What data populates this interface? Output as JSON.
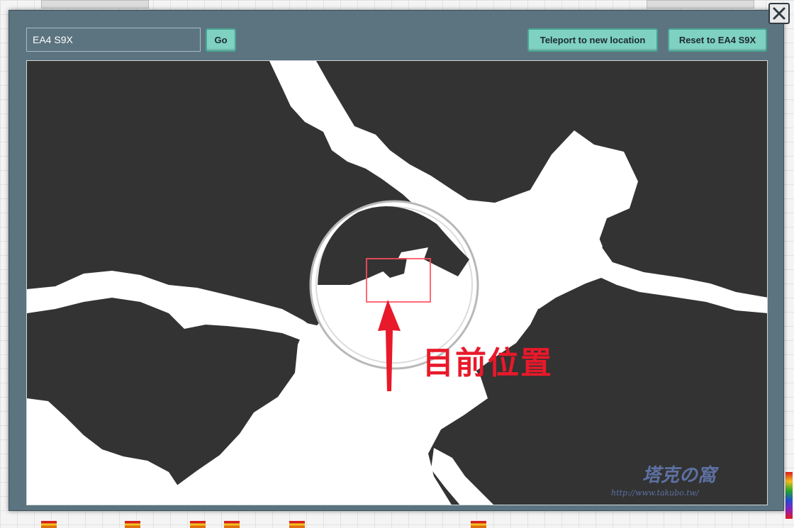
{
  "search": {
    "value": "EA4 S9X"
  },
  "buttons": {
    "go": "Go",
    "teleport": "Teleport to new location",
    "reset": "Reset to EA4 S9X"
  },
  "annotation": {
    "label": "目前位置"
  },
  "watermark": {
    "title": "塔克の窩",
    "url": "http://www.takubo.tw/"
  },
  "icons": {
    "close": "close-icon"
  },
  "colors": {
    "modal_bg": "#5c7380",
    "button_bg": "#7fd1c2",
    "land": "#333333",
    "water": "#ffffff",
    "annotation": "#e8192a"
  }
}
